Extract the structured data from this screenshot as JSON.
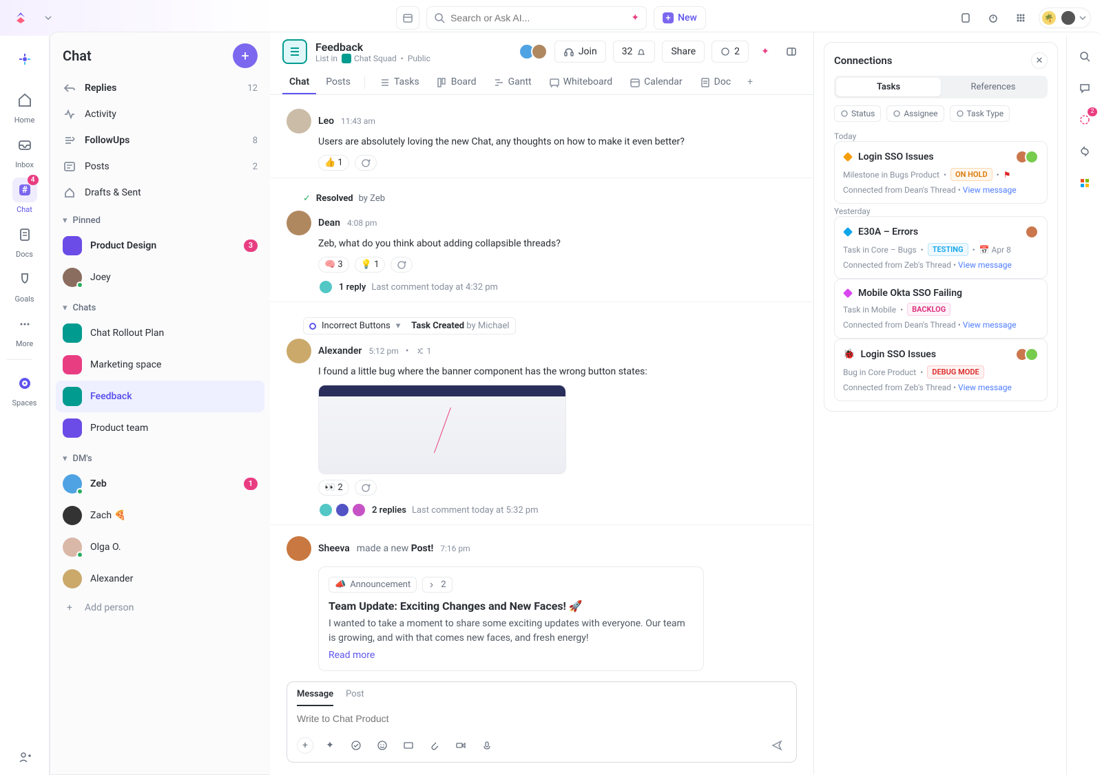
{
  "topbar": {
    "search_placeholder": "Search or Ask AI...",
    "new_label": "New"
  },
  "nav_rail": [
    {
      "key": "home",
      "label": "Home"
    },
    {
      "key": "inbox",
      "label": "Inbox"
    },
    {
      "key": "chat",
      "label": "Chat",
      "badge": "4",
      "active": true
    },
    {
      "key": "docs",
      "label": "Docs"
    },
    {
      "key": "goals",
      "label": "Goals"
    },
    {
      "key": "more",
      "label": "More"
    },
    {
      "key": "spaces",
      "label": "Spaces"
    }
  ],
  "chat_sidebar": {
    "title": "Chat",
    "top_items": [
      {
        "icon": "reply",
        "label": "Replies",
        "count": "12",
        "bold": true
      },
      {
        "icon": "activity",
        "label": "Activity"
      },
      {
        "icon": "followups",
        "label": "FollowUps",
        "count": "8",
        "bold": true
      },
      {
        "icon": "posts",
        "label": "Posts",
        "count": "2"
      },
      {
        "icon": "drafts",
        "label": "Drafts & Sent"
      }
    ],
    "sections": [
      {
        "title": "Pinned",
        "items": [
          {
            "label": "Product Design",
            "badge": "3",
            "bold": true,
            "avatar_bg": "#6b4ce6"
          },
          {
            "label": "Joey",
            "avatar_bg": "#8a6d5e",
            "round": true,
            "presence": true
          }
        ]
      },
      {
        "title": "Chats",
        "items": [
          {
            "label": "Chat Rollout Plan",
            "avatar_bg": "#019b8f"
          },
          {
            "label": "Marketing space",
            "avatar_bg": "#e93d82"
          },
          {
            "label": "Feedback",
            "avatar_bg": "#019b8f",
            "active": true
          },
          {
            "label": "Product team",
            "avatar_bg": "#6b4ce6"
          }
        ]
      },
      {
        "title": "DM's",
        "items": [
          {
            "label": "Zeb",
            "badge": "1",
            "bold": true,
            "round": true,
            "avatar_bg": "#4fa3e3",
            "presence": true
          },
          {
            "label": "Zach 🍕",
            "round": true,
            "avatar_bg": "#333"
          },
          {
            "label": "Olga O.",
            "round": true,
            "avatar_bg": "#d9b8a8",
            "presence": true
          },
          {
            "label": "Alexander",
            "round": true,
            "avatar_bg": "#caa96b"
          }
        ],
        "footer": {
          "label": "Add person"
        }
      }
    ]
  },
  "page": {
    "title": "Feedback",
    "list_in": "List in",
    "squad": "Chat Squad",
    "visibility": "Public",
    "join": "Join",
    "member_count": "32",
    "share": "Share",
    "guest_count": "2",
    "view_tabs": [
      "Chat",
      "Posts"
    ],
    "views": [
      {
        "icon": "list",
        "label": "Tasks"
      },
      {
        "icon": "board",
        "label": "Board"
      },
      {
        "icon": "gantt",
        "label": "Gantt"
      },
      {
        "icon": "whiteboard",
        "label": "Whiteboard"
      },
      {
        "icon": "calendar",
        "label": "Calendar"
      },
      {
        "icon": "doc",
        "label": "Doc"
      }
    ]
  },
  "messages": [
    {
      "author": "Leo",
      "time": "11:43 am",
      "body": "Users are absolutely loving the new Chat, any thoughts on how to make it even better?",
      "reactions": [
        {
          "emoji": "👍",
          "count": "1"
        }
      ],
      "avatar_bg": "#cabca6"
    },
    {
      "resolved_by": "Zeb",
      "author": "Dean",
      "time": "4:08 pm",
      "body": "Zeb, what do you think about adding collapsible threads?",
      "reactions": [
        {
          "emoji": "🧠",
          "count": "3"
        },
        {
          "emoji": "💡",
          "count": "1"
        }
      ],
      "thread": {
        "count": "1 reply",
        "meta": "Last comment today at 4:32 pm"
      },
      "avatar_bg": "#b08860"
    },
    {
      "task_chip": {
        "label": "Incorrect Buttons",
        "created_label": "Task Created",
        "created_by": "by Michael"
      },
      "author": "Alexander",
      "time": "5:12 pm",
      "subtask_count": "1",
      "body": "I found a little bug where the banner component has the wrong button states:",
      "attachment": true,
      "reactions": [
        {
          "emoji": "👀",
          "count": "2"
        }
      ],
      "thread": {
        "count": "2 replies",
        "meta": "Last comment today at 5:32 pm",
        "avatars": 3
      },
      "avatar_bg": "#caa96b"
    },
    {
      "author": "Sheeva",
      "action": "made a new",
      "action_target": "Post!",
      "time": "7:16 pm",
      "avatar_bg": "#c87840",
      "post": {
        "tag": "Announcement",
        "sub_count": "2",
        "title": "Team Update: Exciting Changes and New Faces! 🚀",
        "body": "I wanted to take a moment to share some exciting updates with everyone. Our team is growing, and with that comes new faces, and fresh energy!",
        "read_more": "Read more"
      }
    }
  ],
  "composer": {
    "tabs": [
      "Message",
      "Post"
    ],
    "placeholder": "Write to Chat Product"
  },
  "connections": {
    "title": "Connections",
    "tabs": [
      "Tasks",
      "References"
    ],
    "filters": [
      "Status",
      "Assignee",
      "Task Type"
    ],
    "groups": [
      {
        "label": "Today",
        "cards": [
          {
            "icon_color": "#f59e0b",
            "title": "Login SSO Issues",
            "meta": "Milestone in Bugs Product",
            "status": "ON HOLD",
            "status_class": "status-onhold",
            "flag": true,
            "avatars": 2,
            "footer_from": "Connected from Dean's Thread",
            "link": "View message"
          }
        ]
      },
      {
        "label": "Yesterday",
        "cards": [
          {
            "icon_color": "#0ea5e9",
            "title": "E30A – Errors",
            "meta": "Task in Core – Bugs",
            "status": "TESTING",
            "status_class": "status-testing",
            "date": "Apr 8",
            "avatars": 1,
            "footer_from": "Connected from Zeb's Thread",
            "link": "View message"
          },
          {
            "icon_color": "#d946ef",
            "title": "Mobile Okta SSO Failing",
            "meta": "Task in Mobile",
            "status": "BACKLOG",
            "status_class": "status-backlog",
            "footer_from": "Connected from Dean's Thread",
            "link": "View message"
          },
          {
            "icon_color": "#dc2626",
            "title": "Login SSO Issues",
            "meta": "Bug in Core Product",
            "status": "DEBUG MODE",
            "status_class": "status-debug",
            "avatars": 2,
            "footer_from": "Connected from Zeb's Thread",
            "link": "View message",
            "bug": true
          }
        ]
      }
    ]
  }
}
